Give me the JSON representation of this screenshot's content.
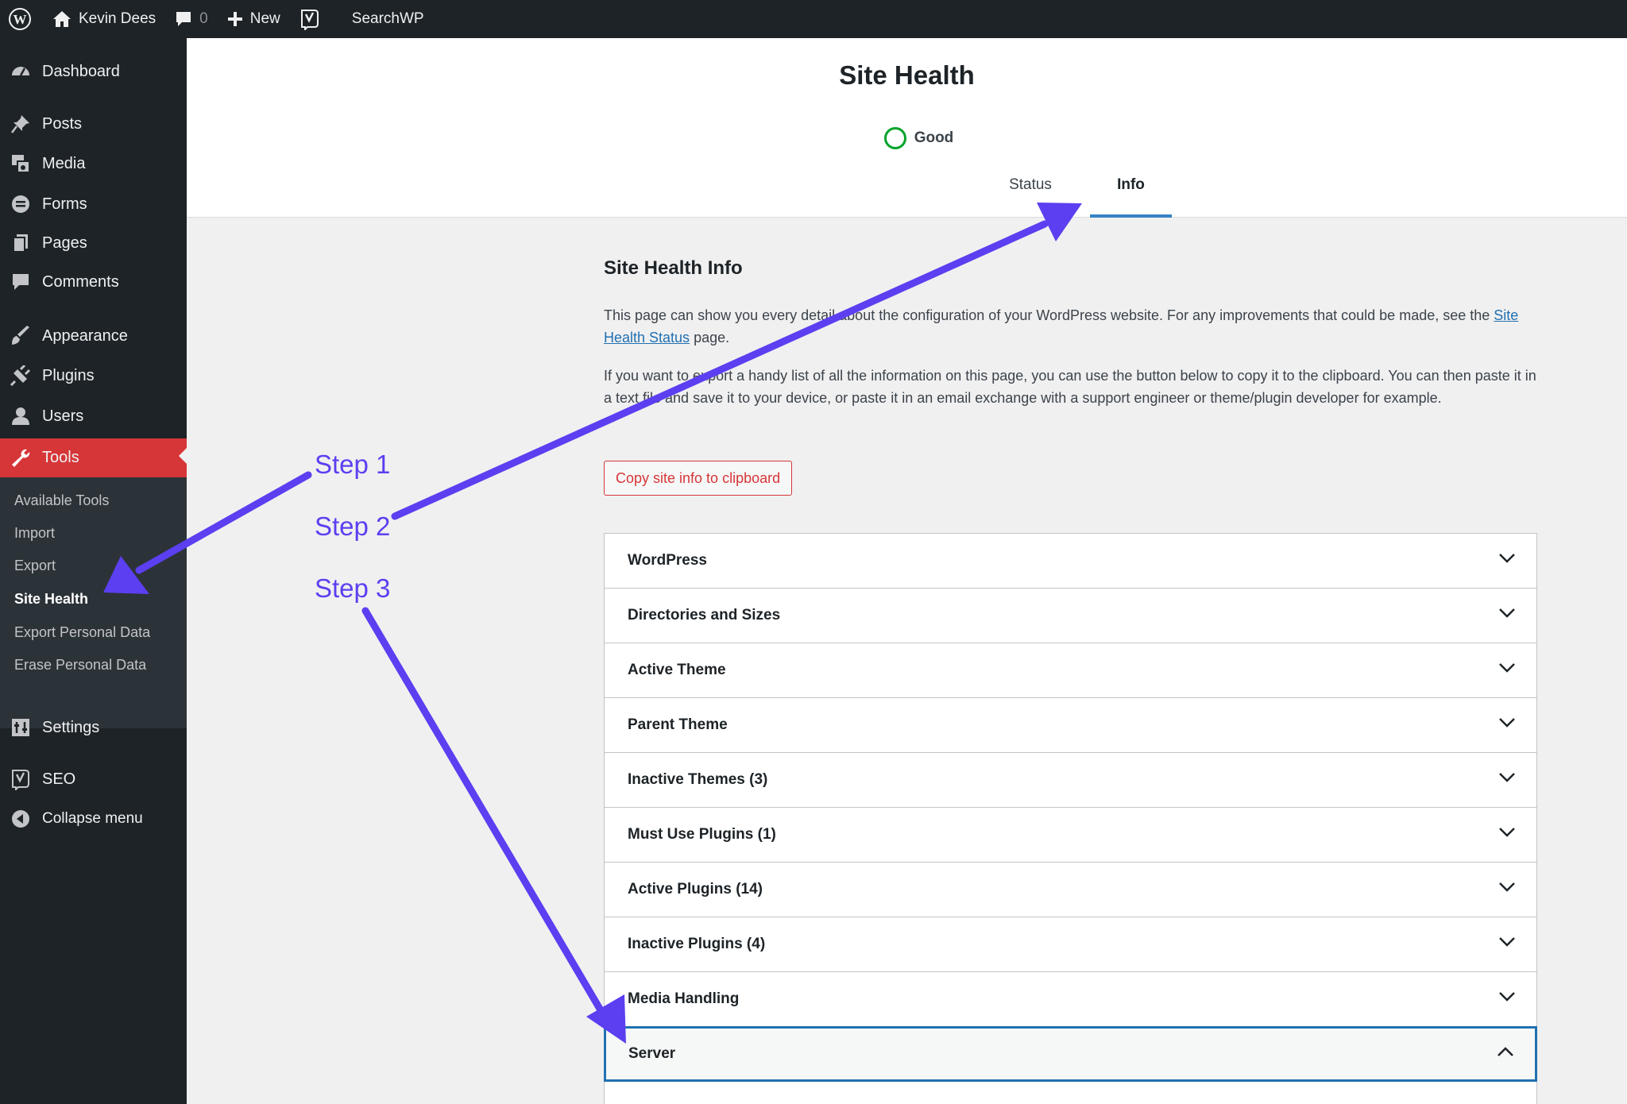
{
  "adminbar": {
    "site_name": "Kevin Dees",
    "comments_count": "0",
    "new_label": "New",
    "searchwp_label": "SearchWP"
  },
  "sidebar": {
    "items": [
      {
        "label": "Dashboard",
        "icon": "dashboard-icon"
      },
      {
        "label": "Posts",
        "icon": "pin-icon"
      },
      {
        "label": "Media",
        "icon": "media-icon"
      },
      {
        "label": "Forms",
        "icon": "forms-icon"
      },
      {
        "label": "Pages",
        "icon": "pages-icon"
      },
      {
        "label": "Comments",
        "icon": "comment-icon"
      },
      {
        "label": "Appearance",
        "icon": "brush-icon"
      },
      {
        "label": "Plugins",
        "icon": "plug-icon"
      },
      {
        "label": "Users",
        "icon": "user-icon"
      },
      {
        "label": "Tools",
        "icon": "wrench-icon"
      },
      {
        "label": "Settings",
        "icon": "settings-icon"
      },
      {
        "label": "SEO",
        "icon": "yoast-icon"
      },
      {
        "label": "Collapse menu",
        "icon": "collapse-icon"
      }
    ],
    "tools_submenu": [
      "Available Tools",
      "Import",
      "Export",
      "Site Health",
      "Export Personal Data",
      "Erase Personal Data"
    ]
  },
  "header": {
    "title": "Site Health",
    "status": "Good",
    "tabs": [
      "Status",
      "Info"
    ]
  },
  "info": {
    "title": "Site Health Info",
    "para1_before": "This page can show you every detail about the configuration of your WordPress website. For any improvements that could be made, see the ",
    "para1_link": "Site Health Status",
    "para1_after": " page.",
    "para2": "If you want to export a handy list of all the information on this page, you can use the button below to copy it to the clipboard. You can then paste it in a text file and save it to your device, or paste it in an email exchange with a support engineer or theme/plugin developer for example.",
    "copy_button": "Copy site info to clipboard"
  },
  "sections": [
    "WordPress",
    "Directories and Sizes",
    "Active Theme",
    "Parent Theme",
    "Inactive Themes (3)",
    "Must Use Plugins (1)",
    "Active Plugins (14)",
    "Inactive Plugins (4)",
    "Media Handling",
    "Server"
  ],
  "annotations": {
    "step1": "Step 1",
    "step2": "Step 2",
    "step3": "Step 3",
    "color": "#5b3ff0"
  },
  "colors": {
    "admin_dark": "#1d2327",
    "active_menu": "#d63638",
    "accent": "#2271b1",
    "good": "#00a32a"
  }
}
